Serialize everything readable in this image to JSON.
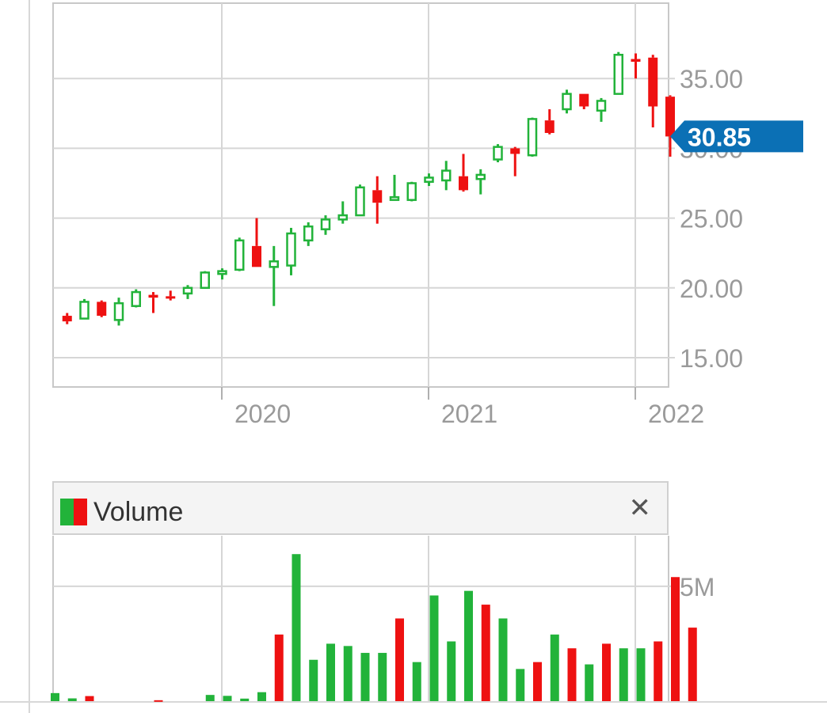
{
  "chart_data": [
    {
      "type": "candlestick",
      "interval": "monthly",
      "ylim": [
        12.9,
        40.4
      ],
      "yticks": [
        "15.00",
        "20.00",
        "25.00",
        "30.00",
        "35.00"
      ],
      "xticks": [
        "2020",
        "2021",
        "2022"
      ],
      "last_price": "30.85",
      "colors": {
        "up": "#22b33a",
        "down": "#ee1111",
        "price_tag": "#0b70b5",
        "grid": "#d6d6d6"
      },
      "candles": [
        {
          "o": 18.0,
          "h": 18.2,
          "l": 17.4,
          "c": 17.6
        },
        {
          "o": 17.8,
          "h": 19.2,
          "l": 17.8,
          "c": 19.0
        },
        {
          "o": 19.0,
          "h": 19.1,
          "l": 17.9,
          "c": 18.0
        },
        {
          "o": 17.7,
          "h": 19.3,
          "l": 17.3,
          "c": 18.9
        },
        {
          "o": 18.7,
          "h": 19.9,
          "l": 18.6,
          "c": 19.7
        },
        {
          "o": 19.5,
          "h": 19.7,
          "l": 18.2,
          "c": 19.3
        },
        {
          "o": 19.4,
          "h": 19.8,
          "l": 19.1,
          "c": 19.3
        },
        {
          "o": 19.6,
          "h": 20.2,
          "l": 19.2,
          "c": 20.0
        },
        {
          "o": 20.0,
          "h": 21.2,
          "l": 20.0,
          "c": 21.1
        },
        {
          "o": 21.0,
          "h": 21.4,
          "l": 20.6,
          "c": 21.2
        },
        {
          "o": 21.3,
          "h": 23.6,
          "l": 21.2,
          "c": 23.4
        },
        {
          "o": 23.0,
          "h": 25.0,
          "l": 21.5,
          "c": 21.5
        },
        {
          "o": 21.5,
          "h": 23.0,
          "l": 18.7,
          "c": 21.9
        },
        {
          "o": 21.6,
          "h": 24.3,
          "l": 20.9,
          "c": 23.9
        },
        {
          "o": 23.4,
          "h": 24.7,
          "l": 23.0,
          "c": 24.4
        },
        {
          "o": 24.2,
          "h": 25.2,
          "l": 23.8,
          "c": 24.9
        },
        {
          "o": 24.9,
          "h": 26.2,
          "l": 24.6,
          "c": 25.2
        },
        {
          "o": 25.2,
          "h": 27.4,
          "l": 25.2,
          "c": 27.2
        },
        {
          "o": 27.0,
          "h": 28.0,
          "l": 24.6,
          "c": 26.1
        },
        {
          "o": 26.3,
          "h": 28.1,
          "l": 26.3,
          "c": 26.5
        },
        {
          "o": 26.3,
          "h": 27.6,
          "l": 26.2,
          "c": 27.5
        },
        {
          "o": 27.6,
          "h": 28.2,
          "l": 27.3,
          "c": 27.9
        },
        {
          "o": 27.7,
          "h": 29.1,
          "l": 27.0,
          "c": 28.4
        },
        {
          "o": 28.0,
          "h": 29.6,
          "l": 26.9,
          "c": 27.0
        },
        {
          "o": 27.8,
          "h": 28.5,
          "l": 26.7,
          "c": 28.1
        },
        {
          "o": 29.2,
          "h": 30.3,
          "l": 29.0,
          "c": 30.1
        },
        {
          "o": 30.0,
          "h": 30.1,
          "l": 28.0,
          "c": 29.6
        },
        {
          "o": 29.5,
          "h": 32.2,
          "l": 29.4,
          "c": 32.1
        },
        {
          "o": 32.0,
          "h": 32.8,
          "l": 31.0,
          "c": 31.1
        },
        {
          "o": 32.8,
          "h": 34.2,
          "l": 32.5,
          "c": 33.9
        },
        {
          "o": 33.9,
          "h": 33.9,
          "l": 32.8,
          "c": 33.0
        },
        {
          "o": 32.7,
          "h": 33.6,
          "l": 31.9,
          "c": 33.4
        },
        {
          "o": 33.9,
          "h": 36.9,
          "l": 33.9,
          "c": 36.7
        },
        {
          "o": 36.4,
          "h": 36.8,
          "l": 35.0,
          "c": 36.2
        },
        {
          "o": 36.5,
          "h": 36.7,
          "l": 31.5,
          "c": 33.0
        },
        {
          "o": 33.7,
          "h": 33.8,
          "l": 29.4,
          "c": 30.85
        }
      ]
    },
    {
      "type": "bar",
      "title": "Volume",
      "ytick": "5M",
      "unit": "M",
      "ylim": [
        0,
        7.2
      ],
      "values": [
        0.35,
        0.12,
        0.22,
        0.0,
        0.0,
        0.0,
        0.04,
        0.0,
        0.0,
        0.27,
        0.23,
        0.11,
        0.39,
        2.9,
        6.4,
        1.8,
        2.5,
        2.4,
        2.1,
        2.1,
        3.6,
        1.7,
        4.6,
        2.6,
        4.8,
        4.2,
        3.6,
        1.4,
        1.7,
        2.9,
        2.3,
        1.6,
        2.5,
        2.3,
        2.3,
        2.6,
        5.4,
        3.2
      ],
      "directions": [
        "up",
        "up",
        "down",
        "up",
        "up",
        "up",
        "down",
        "up",
        "up",
        "up",
        "up",
        "up",
        "up",
        "down",
        "up",
        "up",
        "up",
        "up",
        "up",
        "up",
        "down",
        "up",
        "up",
        "up",
        "up",
        "down",
        "up",
        "up",
        "down",
        "up",
        "down",
        "up",
        "down",
        "up",
        "up",
        "down",
        "down",
        "down"
      ]
    }
  ],
  "volume_panel": {
    "title": "Volume",
    "close_glyph": "✕"
  }
}
